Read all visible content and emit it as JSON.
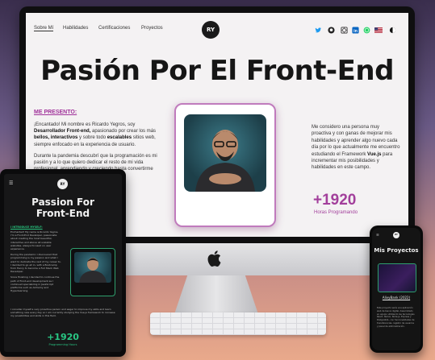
{
  "desktop": {
    "nav": {
      "items": [
        "Sobre Mí",
        "Habilidades",
        "Certificaciones",
        "Proyectos"
      ],
      "logo": "RY"
    },
    "social_icons": [
      "twitter-icon",
      "github-icon",
      "codepen-icon",
      "linkedin-icon",
      "whatsapp-icon",
      "language-flag-icon",
      "theme-toggle-icon"
    ],
    "hero_title": "Pasión Por El Front-End",
    "about_label": "ME PRESENTO:",
    "about_p1_pre": "¡Encantado! Mi nombre es Ricardo Yegros, soy ",
    "about_p1_b1": "Desarrollador Front-end,",
    "about_p1_mid": " apasionado por crear los más ",
    "about_p1_b2": "bellos, interactivos",
    "about_p1_mid2": " y sobre todo ",
    "about_p1_b3": "escalables",
    "about_p1_post": " sitios web, siempre enfocado en la experiencia de usuario.",
    "about_p2": "Durante la pandemia descubrí que la programación es mi pasión y a lo que quiero dedicar el resto de mi vida profesional, aprendiendo y creciendo hasta convertirme en un gran Desarrollador",
    "about_p3": "Me considero una persona muy proactiva y con ganas de mejorar mis habilidades y aprender algo nuevo cada día por lo que actualmente me encuentro estudiando el Framework ",
    "about_p3_b": "Vue.js",
    "about_p3_post": " para incrementar mis posibilidades y habilidades en este campo.",
    "stat_value": "+1920",
    "stat_label": "Horas Programando"
  },
  "tablet": {
    "logo": "RY",
    "title_l1": "Passion For",
    "title_l2": "Front-End",
    "label": "I INTRODUCE MYSELF:",
    "text1": "Enchanted! My name is Ricardo Yegros, I'm a Front-End Developer, passionate about creating the most beautiful, interactive and above all scalable websites, always focused on user experience.",
    "text2": "During the pandemic I discovered that programming is my passion and what I want to dedicate the rest of my career to. I decided to go all in, with a Bootcamp from Henry to become a Full Stack Web Developer.",
    "text3": "Since finishing I decided to continue the path of Front-end development as I continued specializing in JavaScript platforms such as Alchemy and Hyperlearning.",
    "para": "I consider myself a very proactive person and eager to improve my skills and learn something new every day so I am currently studying the Vue.js framework to increase my possibilities and skills in this field.",
    "stat_value": "+1920",
    "stat_label": "Programming Hours"
  },
  "phone": {
    "logo": "RY",
    "title": "Mis Proyectos",
    "card_name": "AlivyBank (2022)",
    "text": "Este proyecto sería una aplicación web de banca digital, desarrollado en equipo utilizando las tecnologías React, Redux, Node.js, Express y PostgreSQL, con funcionalidades de transferencias, registro de usuarios y panel de administración."
  },
  "colors": {
    "accent_desktop": "#a23f9b",
    "accent_mobile": "#29c784"
  }
}
